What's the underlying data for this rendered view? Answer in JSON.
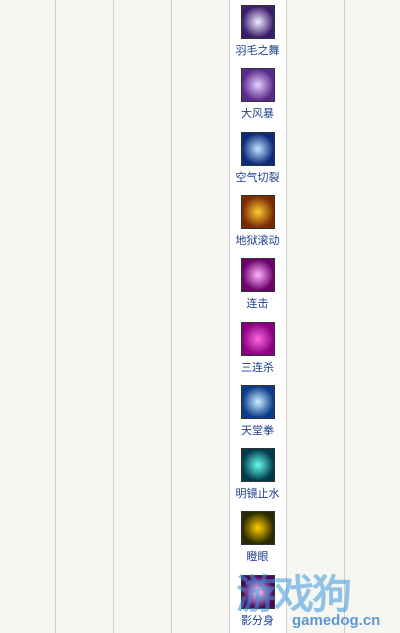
{
  "skills": [
    {
      "name": "羽毛之舞",
      "icon": "feather-dance-icon",
      "colors": [
        "#3b1b6b",
        "#f0f0ff"
      ]
    },
    {
      "name": "大风暴",
      "icon": "big-storm-icon",
      "colors": [
        "#5a2a8a",
        "#e8d0ff"
      ]
    },
    {
      "name": "空气切裂",
      "icon": "air-slash-icon",
      "colors": [
        "#0a2a7a",
        "#bfe6ff"
      ]
    },
    {
      "name": "地狱滚动",
      "icon": "hell-roll-icon",
      "colors": [
        "#7a2a00",
        "#ffcc33"
      ]
    },
    {
      "name": "连击",
      "icon": "combo-icon",
      "colors": [
        "#6a006a",
        "#ffb3ff"
      ]
    },
    {
      "name": "三连杀",
      "icon": "triple-kill-icon",
      "colors": [
        "#8a0080",
        "#ff66dd"
      ]
    },
    {
      "name": "天堂拳",
      "icon": "heaven-fist-icon",
      "colors": [
        "#0a3a8a",
        "#cdefff"
      ]
    },
    {
      "name": "明镜止水",
      "icon": "calm-mirror-icon",
      "colors": [
        "#003a4a",
        "#66ffee"
      ]
    },
    {
      "name": "瞪眼",
      "icon": "glare-eye-icon",
      "colors": [
        "#2a2a00",
        "#ffcc00"
      ]
    },
    {
      "name": "影分身",
      "icon": "shadow-clone-icon",
      "colors": [
        "#4a0a5a",
        "#ffd0ff"
      ]
    }
  ],
  "watermark": {
    "logo": "游戏狗",
    "url": "gamedog.cn"
  }
}
